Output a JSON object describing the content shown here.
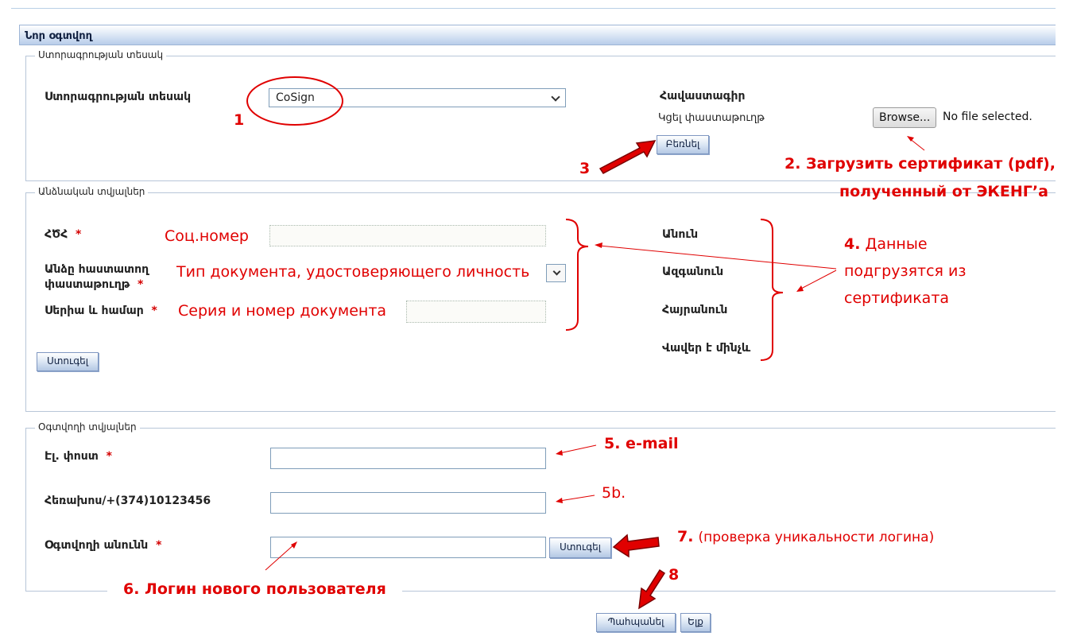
{
  "window": {
    "title": "Նոր օգտվող"
  },
  "sections": {
    "signature": {
      "legend": "Ստորագրության տեսակ"
    },
    "personal": {
      "legend": "Անձնական տվյալներ"
    },
    "user": {
      "legend": "Օգտվողի տվյալներ"
    }
  },
  "signature": {
    "type_label": "Ստորագրության տեսակ",
    "type_value": "CoSign",
    "cert_title": "Հավաստագիր",
    "attach_label": "Կցել փաստաթուղթ",
    "browse_label": "Browse...",
    "file_status": "No file selected.",
    "upload_button": "Բեռնել"
  },
  "personal": {
    "ssn_label": "ՀԾՀ",
    "id_doc_label_line1": "Անձը հաստատող",
    "id_doc_label_line2": "փաստաթուղթ",
    "series_label": "Սերիա և համար",
    "check_button": "Ստուգել",
    "cert_fields": [
      "Անուն",
      "Ազգանուն",
      "Հայրանուն",
      "Վավեր է մինչև"
    ]
  },
  "user": {
    "email_label": "Էլ. փոստ",
    "phone_label": "Հեռախոս/+(374)10123456",
    "username_label": "Օգտվողի անունն",
    "check_button": "Ստուգել"
  },
  "footer": {
    "save_button": "Պահպանել",
    "exit_button": "Ելք"
  },
  "required_mark": "*",
  "annotations": {
    "n1": "1",
    "n2_line1": "2. Загрузить сертификат (pdf),",
    "n2_line2": "полученный от ЭКЕНГ’а",
    "n3": "3",
    "ssn_hint": "Соц.номер",
    "doc_hint": "Тип документа, удостоверяющего личность",
    "series_hint": "Серия и номер документа",
    "n4_num": "4.",
    "n4_line1": "Данные",
    "n4_line2": "подгрузятся из",
    "n4_line3": "сертификата",
    "n5": "5. e-mail",
    "n5b": "5b.",
    "n6": "6. Логин нового пользователя",
    "n7_num": "7.",
    "n7_text": "(проверка уникальности логина)",
    "n8": "8"
  },
  "colors": {
    "annotation": "#e00000",
    "title_bar": "#b8cdea",
    "button": "#dbe6f4"
  }
}
